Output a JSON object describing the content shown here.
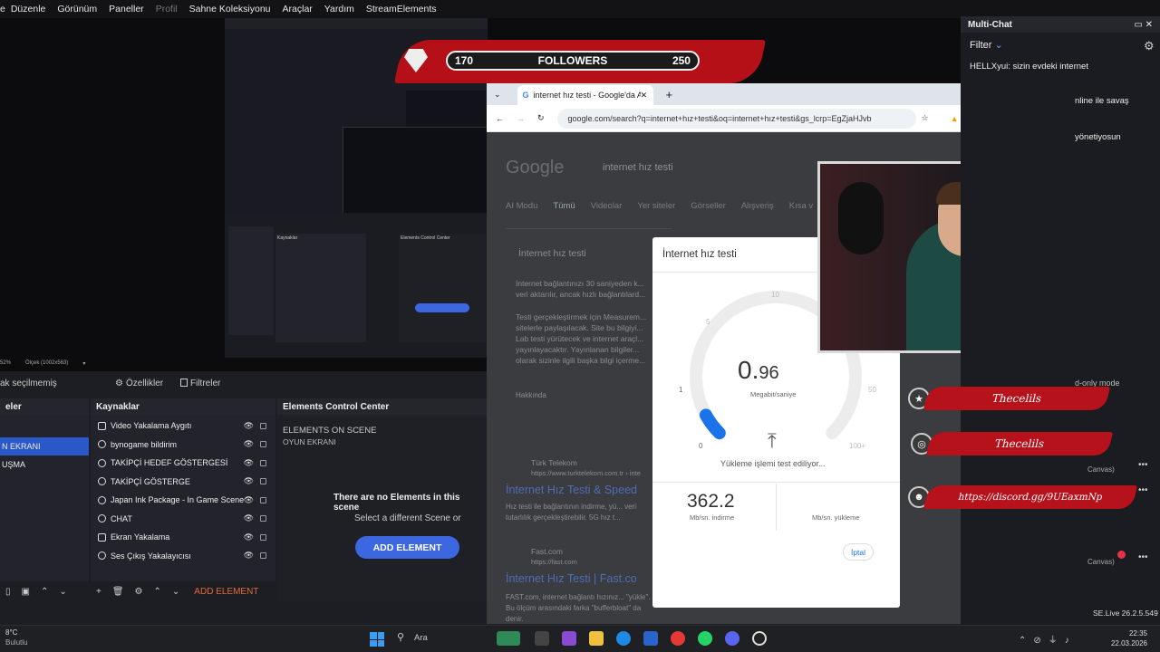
{
  "menubar": {
    "items": [
      "Düzenle",
      "Görünüm",
      "Paneller",
      "Profil",
      "Sahne Koleksiyonu",
      "Araçlar",
      "Yardım",
      "StreamElements"
    ]
  },
  "followers": {
    "current": "170",
    "label": "FOLLOWERS",
    "goal": "250"
  },
  "obs": {
    "scene_sel_label": "ak seçilmemiş",
    "zoom": "Ölçek (1002x563)",
    "zoom_prefix": "52%",
    "properties": "Özellikler",
    "filters": "Filtreler",
    "scenes_title": "eler",
    "scenes": [
      "",
      "N EKRANI",
      "UŞMA"
    ],
    "sources_title": "Kaynaklar",
    "sources": [
      "Video Yakalama Aygıtı",
      "bynogame bildirim",
      "TAKİPÇİ HEDEF GÖSTERGESİ",
      "TAKİPÇİ GÖSTERGE",
      "Japan Ink Package - In Game Scene",
      "CHAT",
      "Ekran Yakalama",
      "Ses Çıkış Yakalayıcısı"
    ],
    "ecc_title": "Elements Control Center",
    "ecc_scene_label": "ELEMENTS ON SCENE",
    "ecc_scene_name": "OYUN EKRANI",
    "ecc_empty": "There are no Elements in this scene",
    "ecc_select": "Select a different Scene or",
    "ecc_add": "ADD ELEMENT",
    "add_element_small": "ADD ELEMENT"
  },
  "browser": {
    "tab_title": "internet hız testi - Google'da Ar",
    "url": "google.com/search?q=internet+hız+testi&oq=internet+hız+testi&gs_lcrp=EgZjaHJvb",
    "search_query": "internet hız testi",
    "nav_tabs": [
      "AI Modu",
      "Tümü",
      "Videolar",
      "Yer siteler",
      "Görseller",
      "Alışveriş",
      "Kısa v"
    ],
    "result_box_title": "İnternet hız testi",
    "result_text": "İnternet bağlantınızı 30 saniyeden k... veri aktarılır, ancak hızlı bağlantılard...",
    "result_text2": "Testi gerçekleştirmek için Measurem... sitelerle paylaşılacak. Site bu bilgiyi... Lab testi yürütecek ve internet araçl... yayınlayacaktır. Yayınlanan bilgiler... olarak sizinle ilgili başka bilgi içerme...",
    "result_more": "Hakkında",
    "r1_source": "Türk Telekom",
    "r1_url": "https://www.turktelekom.com.tr › inte",
    "r1_title": "İnternet Hız Testi & Speed",
    "r1_desc": "Hız testi ile bağlantının indirme, yü... veri tutarlılık gerçekleştirebilir. 5G hız t...",
    "r2_source": "Fast.com",
    "r2_url": "https://fast.com",
    "r2_title": "İnternet Hız Testi | Fast.co",
    "r2_desc": "FAST.com, internet bağlantı hızınız... \"yükle\". Bu ölçüm arasındaki farka \"bufferbloat\" da denir."
  },
  "speedtest": {
    "title": "İnternet hız testi",
    "value_int": "0.",
    "value_dec": "96",
    "unit": "Megabit/saniye",
    "ticks": [
      "0",
      "1",
      "5",
      "10",
      "50",
      "100+"
    ],
    "status": "Yükleme işlemi test ediliyor...",
    "download_value": "362.2",
    "download_label": "Mb/sn. indirme",
    "upload_label": "Mb/sn. yükleme",
    "cancel": "İptal",
    "gauge_progress": 0.06
  },
  "multichat": {
    "title": "Multi-Chat",
    "filter": "Filter",
    "msgs": [
      "HELLXyui: sizin evdeki internet",
      "nline ile savaş",
      "yönetiyosun"
    ],
    "readonly": "d-only mode",
    "items": [
      "Canvas)",
      "Canvas)"
    ],
    "version": "SE.Live 26.2.5.549"
  },
  "social": {
    "star_name": "Thecelils",
    "ig_name": "Thecelils",
    "discord": "https://discord.gg/9UEaxmNp"
  },
  "taskbar": {
    "temp": "8°C",
    "weather": "Bulutlu",
    "search": "Ara",
    "time": "22:35",
    "date": "22.03.2026"
  }
}
